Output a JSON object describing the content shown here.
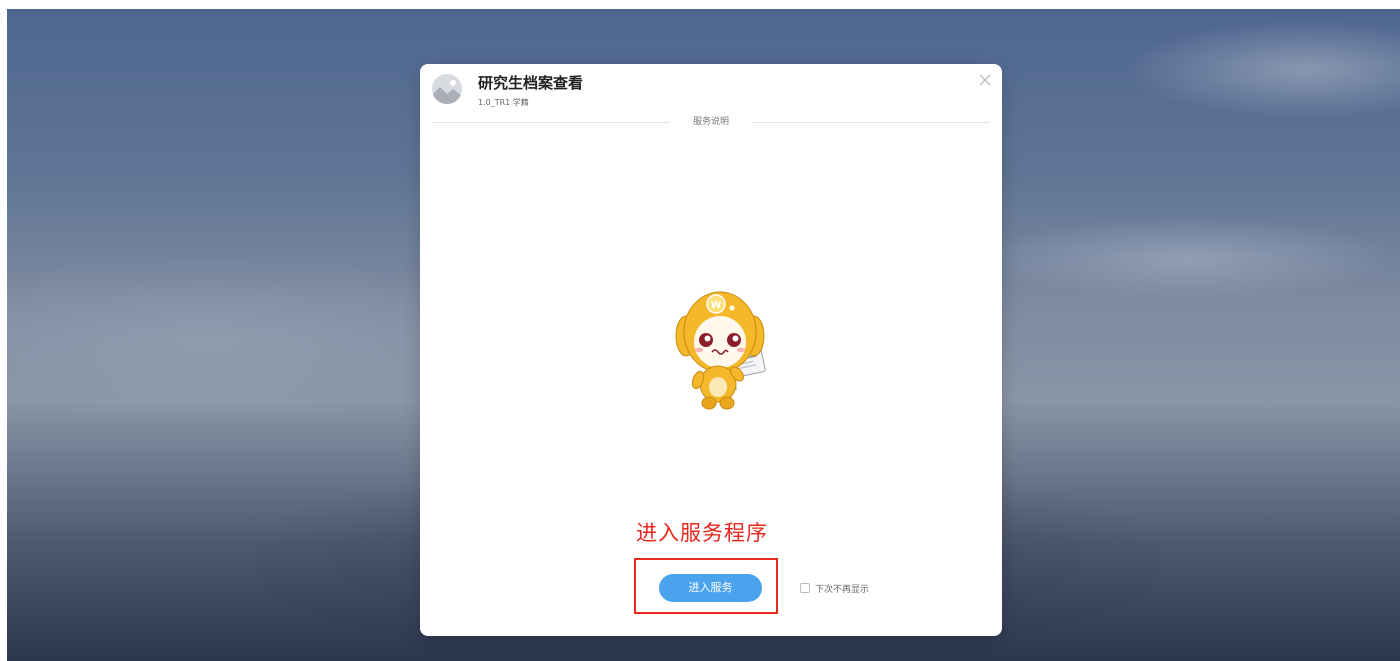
{
  "dialog": {
    "app_title": "研究生档案查看",
    "app_version": "1.0_TR1 学籍",
    "section_label": "服务说明",
    "enter_button_label": "进入服务",
    "dont_show_again_label": "下次不再显示",
    "dont_show_again_checked": false
  },
  "annotation": {
    "text": "进入服务程序",
    "color": "#e8281d"
  },
  "colors": {
    "primary_button": "#4ba3ee",
    "mascot_yellow": "#f5b82a"
  },
  "icons": {
    "close": "close-icon",
    "app_logo": "app-logo-icon",
    "mascot": "mascot-illustration"
  }
}
